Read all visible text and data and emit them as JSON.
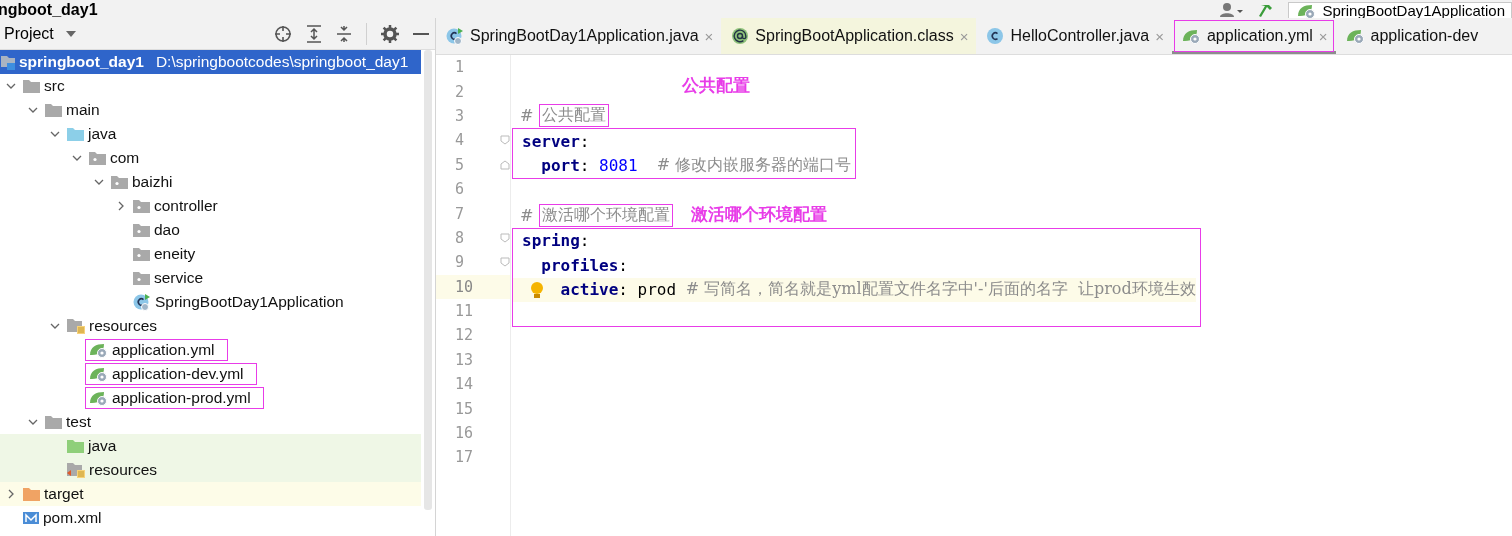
{
  "title_bar": {
    "title": "ngboot_day1",
    "run_config": "SpringBootDay1Application"
  },
  "project": {
    "header": "Project",
    "tree": [
      {
        "label": "springboot_day1",
        "path": "D:\\springbootcodes\\springboot_day1",
        "kind": "module",
        "selected": true,
        "framed": false,
        "children": [
          {
            "label": "src",
            "kind": "folder",
            "expanded": true,
            "selected": false,
            "framed": false,
            "children": [
              {
                "label": "main",
                "kind": "folder",
                "expanded": true,
                "selected": false,
                "framed": false,
                "children": [
                  {
                    "label": "java",
                    "kind": "source",
                    "expanded": true,
                    "selected": false,
                    "framed": false,
                    "children": [
                      {
                        "label": "com",
                        "kind": "package",
                        "expanded": true,
                        "selected": false,
                        "framed": false,
                        "children": [
                          {
                            "label": "baizhi",
                            "kind": "package",
                            "expanded": true,
                            "selected": false,
                            "framed": false,
                            "children": [
                              {
                                "label": "controller",
                                "kind": "package",
                                "expanded": false,
                                "selected": false,
                                "framed": false
                              },
                              {
                                "label": "dao",
                                "kind": "package",
                                "selected": false,
                                "framed": false
                              },
                              {
                                "label": "eneity",
                                "kind": "package",
                                "selected": false,
                                "framed": false
                              },
                              {
                                "label": "service",
                                "kind": "package",
                                "selected": false,
                                "framed": false
                              },
                              {
                                "label": "SpringBootDay1Application",
                                "kind": "spring-class",
                                "selected": false,
                                "framed": false
                              }
                            ]
                          }
                        ]
                      }
                    ]
                  },
                  {
                    "label": "resources",
                    "kind": "resources",
                    "expanded": true,
                    "selected": false,
                    "framed": false,
                    "children": [
                      {
                        "label": "application.yml",
                        "kind": "yml",
                        "selected": false,
                        "framed": true
                      },
                      {
                        "label": "application-dev.yml",
                        "kind": "yml",
                        "selected": false,
                        "framed": true
                      },
                      {
                        "label": "application-prod.yml",
                        "kind": "yml",
                        "selected": false,
                        "framed": true
                      }
                    ]
                  }
                ]
              },
              {
                "label": "test",
                "kind": "folder",
                "expanded": true,
                "selected": false,
                "framed": false,
                "children": [
                  {
                    "label": "java",
                    "kind": "test-source",
                    "selected": false,
                    "framed": false
                  },
                  {
                    "label": "resources",
                    "kind": "test-resources",
                    "selected": false,
                    "framed": false
                  }
                ]
              }
            ]
          },
          {
            "label": "target",
            "kind": "excluded",
            "expanded": false,
            "selected": false,
            "framed": false
          },
          {
            "label": "pom.xml",
            "kind": "maven",
            "selected": false,
            "framed": false
          }
        ]
      }
    ]
  },
  "tabs": [
    {
      "label": "SpringBootDay1Application.java",
      "kind": "spring-class",
      "selected": false,
      "framed": false,
      "close": "×"
    },
    {
      "label": "SpringBootApplication.class",
      "kind": "annotation",
      "selected": false,
      "framed": false,
      "close": "×"
    },
    {
      "label": "HelloController.java",
      "kind": "class",
      "selected": false,
      "framed": false,
      "close": "×"
    },
    {
      "label": "application.yml",
      "kind": "yml",
      "selected": true,
      "framed": true,
      "close": "×"
    },
    {
      "label": "application-dev",
      "kind": "yml",
      "selected": false,
      "framed": false
    }
  ],
  "editor": {
    "lines": [
      {
        "number": "1",
        "kind": "plain",
        "current": false,
        "framed": false
      },
      {
        "number": "2",
        "kind": "plain",
        "current": false,
        "framed": false,
        "note": "公共配置"
      },
      {
        "number": "3",
        "kind": "plain",
        "current": false,
        "framed": false,
        "tokens": [
          {
            "text": "# ",
            "kind": "comment",
            "framed": false
          },
          {
            "text": "公共配置",
            "kind": "comment",
            "framed": true
          }
        ]
      },
      {
        "number": "4",
        "kind": "fold-start",
        "current": false,
        "framed": true,
        "tokens": [
          {
            "text": "server",
            "kind": "key",
            "framed": false
          },
          {
            "text": ":",
            "kind": "punct",
            "framed": false
          }
        ]
      },
      {
        "number": "5",
        "kind": "fold-end",
        "current": false,
        "framed": true,
        "tokens": [
          {
            "text": "  port",
            "kind": "key",
            "framed": false
          },
          {
            "text": ": ",
            "kind": "punct",
            "framed": false
          },
          {
            "text": "8081",
            "kind": "number",
            "framed": false
          },
          {
            "text": "  # 修改内嵌服务器的端口号",
            "kind": "comment",
            "framed": false
          }
        ]
      },
      {
        "number": "6",
        "kind": "plain",
        "current": false,
        "framed": false
      },
      {
        "number": "7",
        "kind": "plain",
        "current": false,
        "framed": false,
        "tokens": [
          {
            "text": "# ",
            "kind": "comment",
            "framed": false
          },
          {
            "text": "激活哪个环境配置",
            "kind": "comment",
            "framed": true
          }
        ],
        "note": "激活哪个环境配置"
      },
      {
        "number": "8",
        "kind": "fold-start",
        "current": false,
        "framed": true,
        "tokens": [
          {
            "text": "spring",
            "kind": "key",
            "framed": false
          },
          {
            "text": ":",
            "kind": "punct",
            "framed": false
          }
        ]
      },
      {
        "number": "9",
        "kind": "fold-start",
        "current": false,
        "framed": true,
        "tokens": [
          {
            "text": "  profiles",
            "kind": "key",
            "framed": false
          },
          {
            "text": ":",
            "kind": "punct",
            "framed": false
          }
        ]
      },
      {
        "number": "10",
        "kind": "plain",
        "current": true,
        "framed": true,
        "bulb": true,
        "tokens": [
          {
            "text": "    active",
            "kind": "key",
            "framed": false
          },
          {
            "text": ": ",
            "kind": "punct",
            "framed": false
          },
          {
            "text": "prod",
            "kind": "value",
            "framed": false
          },
          {
            "text": " # 写简名，简名就是yml配置文件名字中'-'后面的名字  让prod环境生效",
            "kind": "comment",
            "framed": false
          }
        ]
      },
      {
        "number": "11",
        "kind": "plain",
        "current": false,
        "framed": true
      },
      {
        "number": "12",
        "kind": "plain",
        "current": false,
        "framed": false
      },
      {
        "number": "13",
        "kind": "plain",
        "current": false,
        "framed": false
      },
      {
        "number": "14",
        "kind": "plain",
        "current": false,
        "framed": false
      },
      {
        "number": "15",
        "kind": "plain",
        "current": false,
        "framed": false
      },
      {
        "number": "16",
        "kind": "plain",
        "current": false,
        "framed": false
      },
      {
        "number": "17",
        "kind": "plain",
        "current": false,
        "framed": false
      }
    ]
  }
}
